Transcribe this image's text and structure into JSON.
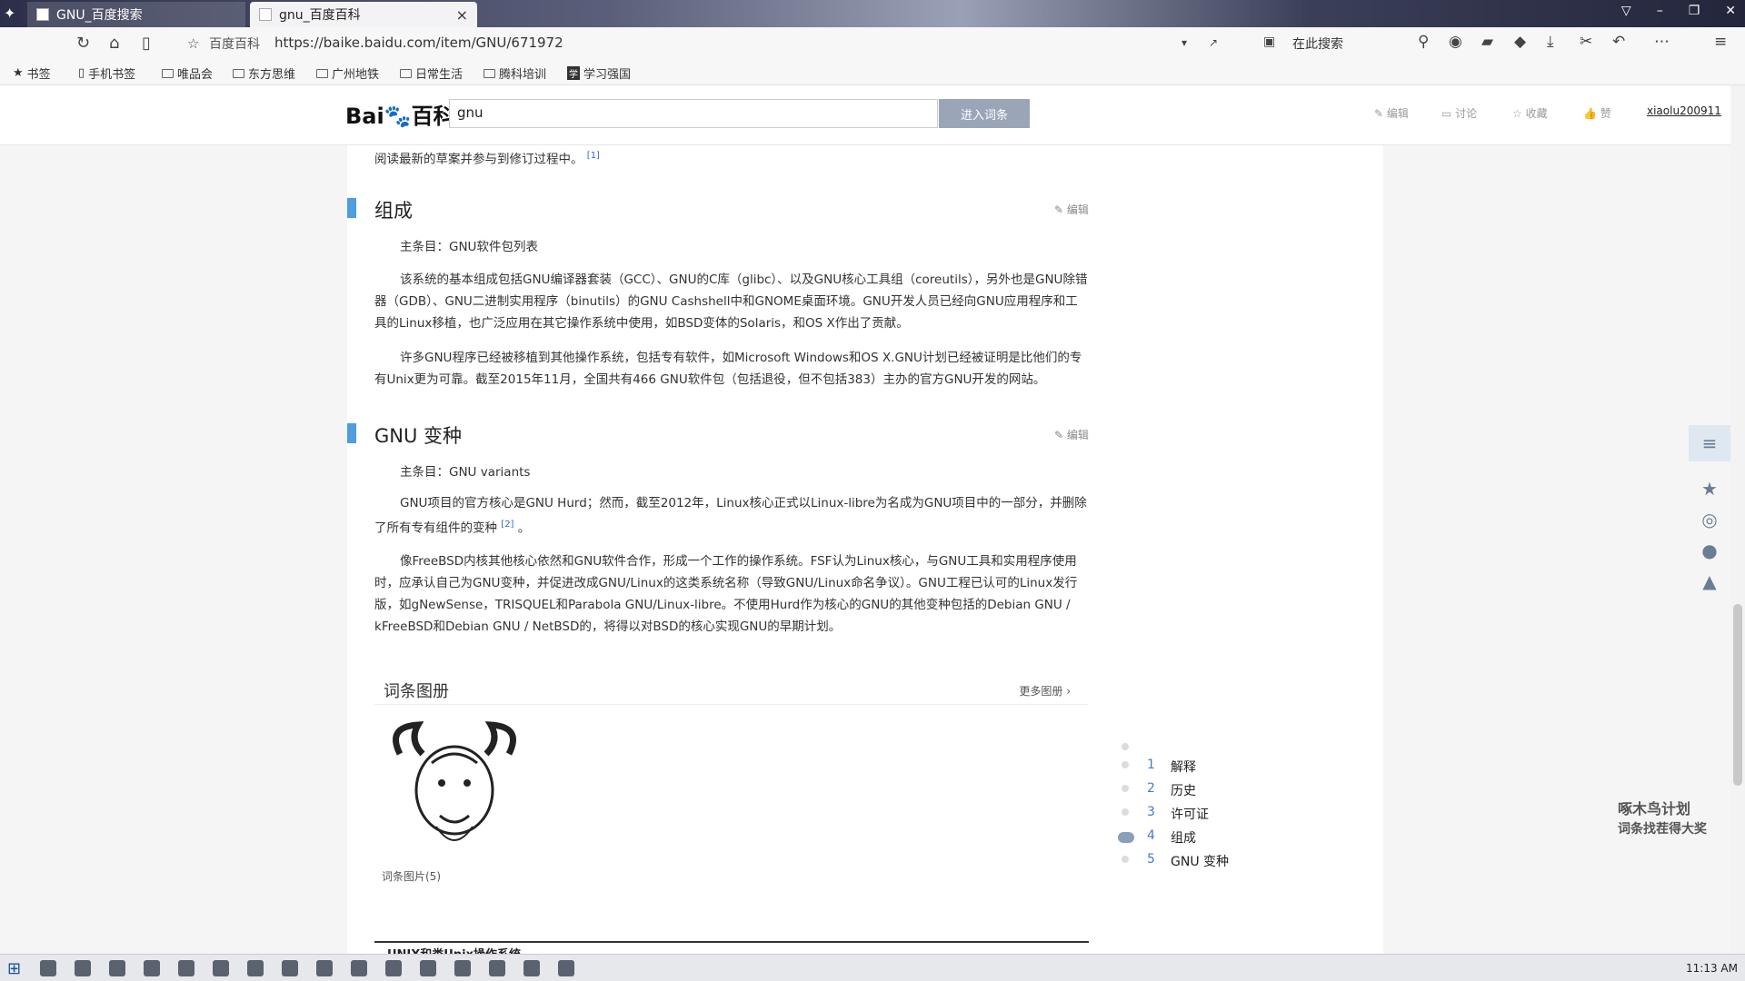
{
  "browser": {
    "tabs": [
      {
        "label": "GNU_百度搜索"
      },
      {
        "label": "gnu_百度百科"
      }
    ],
    "url_site": "百度百科",
    "url": "https://baike.baidu.com/item/GNU/671972",
    "search_label": "在此搜索",
    "close_glyph": "×"
  },
  "bookmarks": [
    "书签",
    "手机书签",
    "唯品会",
    "东方思维",
    "广州地铁",
    "日常生活",
    "腾科培训",
    "学习强国"
  ],
  "baike": {
    "logo_text": "百科",
    "search_value": "gnu",
    "enter_button": "进入词条",
    "actions": [
      "编辑",
      "讨论",
      "收藏",
      "赞"
    ],
    "user": "xiaolu200911"
  },
  "article": {
    "intro_tail": "阅读最新的草案并参与到修订过程中。",
    "ref1": "[1]",
    "sections": [
      {
        "title": "组成",
        "edit": "编辑",
        "main_entry": "主条目：GNU软件包列表",
        "p1": "该系统的基本组成包括GNU编译器套装（GCC）、GNU的C库（glibc）、以及GNU核心工具组（coreutils），另外也是GNU除错器（GDB）、GNU二进制实用程序（binutils）的GNU Cashshell中和GNOME桌面环境。GNU开发人员已经向GNU应用程序和工具的Linux移植，也广泛应用在其它操作系统中使用，如BSD变体的Solaris，和OS X作出了贡献。",
        "p2": "许多GNU程序已经被移植到其他操作系统，包括专有软件，如Microsoft Windows和OS X.GNU计划已经被证明是比他们的专有Unix更为可靠。截至2015年11月，全国共有466 GNU软件包（包括退役，但不包括383）主办的官方GNU开发的网站。"
      },
      {
        "title": "GNU 变种",
        "edit": "编辑",
        "main_entry": "主条目：GNU variants",
        "p1": "GNU项目的官方核心是GNU Hurd；然而，截至2012年，Linux核心正式以Linux-libre为名成为GNU项目中的一部分，并删除了所有专有组件的变种",
        "ref2": "[2]",
        "p1_tail": "。",
        "p2": "像FreeBSD内核其他核心依然和GNU软件合作，形成一个工作的操作系统。FSF认为Linux核心，与GNU工具和实用程序使用时，应承认自己为GNU变种，并促进改成GNU/Linux的这类系统名称（导致GNU/Linux命名争议）。GNU工程已认可的Linux发行版，如gNewSense，TRISQUEL和Parabola GNU/Linux-libre。不使用Hurd作为核心的GNU的其他变种包括的Debian GNU / kFreeBSD和Debian GNU / NetBSD的，将得以对BSD的核心实现GNU的早期计划。"
      }
    ],
    "album": {
      "title": "词条图册",
      "more": "更多图册",
      "caption": "词条图片(5)"
    },
    "bottom_title": "UNIX和类Unix操作系统"
  },
  "toc": [
    {
      "num": "1",
      "label": "解释"
    },
    {
      "num": "2",
      "label": "历史"
    },
    {
      "num": "3",
      "label": "许可证"
    },
    {
      "num": "4",
      "label": "组成"
    },
    {
      "num": "5",
      "label": "GNU 变种"
    }
  ],
  "side_promo": {
    "line1": "啄木鸟计划",
    "line2": "词条找茬得大奖"
  },
  "taskbar": {
    "clock": "11:13 AM"
  }
}
